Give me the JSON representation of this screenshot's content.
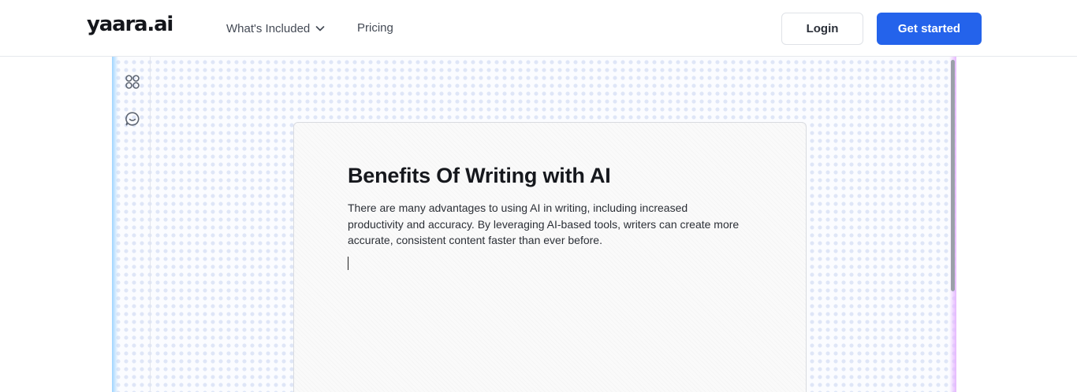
{
  "header": {
    "logo": "yaara.ai",
    "nav": {
      "whats_included": "What's Included",
      "pricing": "Pricing"
    },
    "login_label": "Login",
    "get_started_label": "Get started"
  },
  "editor": {
    "sidebar_tools": [
      {
        "icon": "apps-grid-icon"
      },
      {
        "icon": "chat-bubble-icon"
      }
    ],
    "document": {
      "title": "Benefits Of Writing with AI",
      "body": "There are many advantages to using AI in writing, including increased productivity and accuracy. By leveraging AI-based tools, writers can create more accurate, consistent content faster than ever before."
    }
  },
  "colors": {
    "primary": "#2463eb",
    "glow_left": "#9fd4ff",
    "glow_right": "#e6b6ff"
  }
}
